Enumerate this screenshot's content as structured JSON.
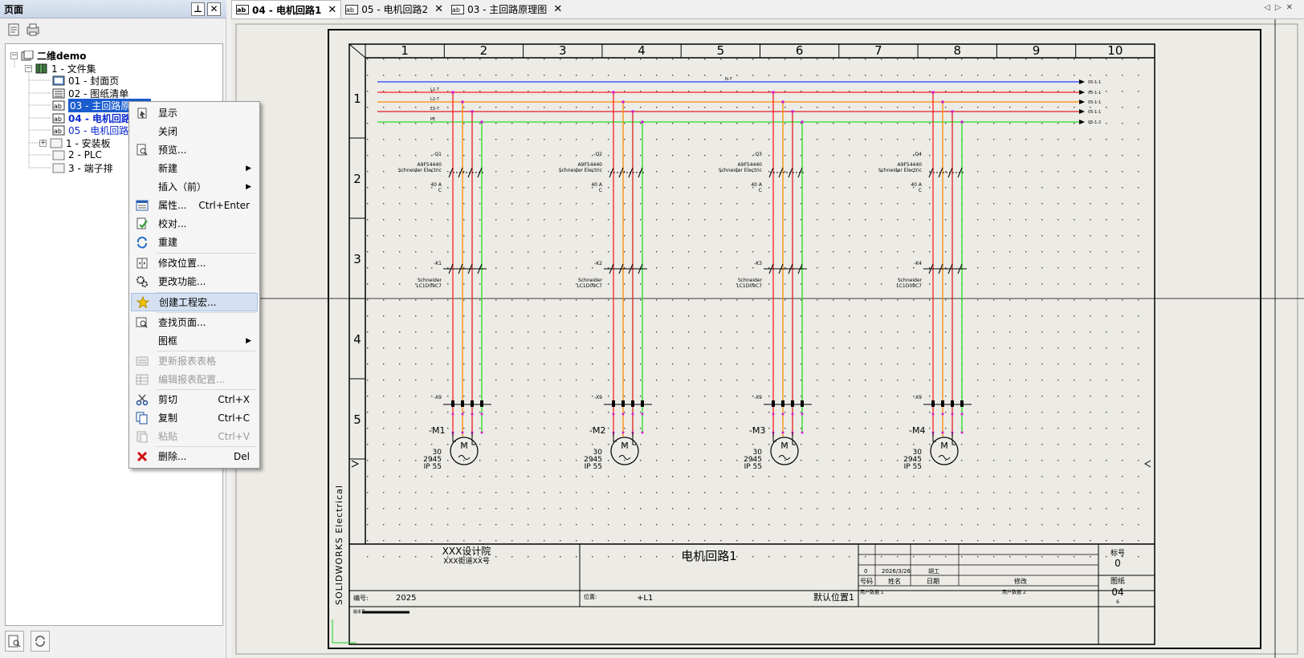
{
  "panel": {
    "title": "页面",
    "pin_label": "⊥",
    "close_label": "✕"
  },
  "tree": {
    "root": "二维demo",
    "folder": "1 - 文件集",
    "items": [
      {
        "label": "01 - 封面页"
      },
      {
        "label": "02 - 图纸清单"
      },
      {
        "label": "03 - 主回路原理图"
      },
      {
        "label": "04 - 电机回路1"
      },
      {
        "label": "05 - 电机回路2"
      }
    ],
    "groups": [
      {
        "label": "1 - 安装板"
      },
      {
        "label": "2 - PLC"
      },
      {
        "label": "3 - 端子排"
      }
    ]
  },
  "context_menu": {
    "items": [
      {
        "label": "显示",
        "shortcut": ""
      },
      {
        "label": "关闭",
        "shortcut": ""
      },
      {
        "label": "预览...",
        "shortcut": ""
      },
      {
        "label": "新建",
        "shortcut": ""
      },
      {
        "label": "插入（前）",
        "shortcut": ""
      },
      {
        "label": "属性...",
        "shortcut": "Ctrl+Enter"
      },
      {
        "label": "校对...",
        "shortcut": ""
      },
      {
        "label": "重建",
        "shortcut": ""
      },
      {
        "label": "修改位置...",
        "shortcut": ""
      },
      {
        "label": "更改功能...",
        "shortcut": ""
      },
      {
        "label": "创建工程宏...",
        "shortcut": ""
      },
      {
        "label": "查找页面...",
        "shortcut": ""
      },
      {
        "label": "图框",
        "shortcut": ""
      },
      {
        "label": "更新报表表格",
        "shortcut": ""
      },
      {
        "label": "编辑报表配置...",
        "shortcut": ""
      },
      {
        "label": "剪切",
        "shortcut": "Ctrl+X"
      },
      {
        "label": "复制",
        "shortcut": "Ctrl+C"
      },
      {
        "label": "粘贴",
        "shortcut": "Ctrl+V"
      },
      {
        "label": "删除...",
        "shortcut": "Del"
      }
    ]
  },
  "tabs": [
    {
      "label": "04 - 电机回路1",
      "close": "✕"
    },
    {
      "label": "05 - 电机回路2",
      "close": "✕"
    },
    {
      "label": "03 - 主回路原理图",
      "close": "✕"
    }
  ],
  "tab_nav": "◁▷✕",
  "drawing": {
    "columns": [
      "1",
      "2",
      "3",
      "4",
      "5",
      "6",
      "7",
      "8",
      "9",
      "10"
    ],
    "rows": [
      "1",
      "2",
      "3",
      "4",
      "5"
    ],
    "bus_labels": [
      "N-7",
      "L1-7",
      "L2-7",
      "L3-7",
      "PE"
    ],
    "bus_targets": [
      "05-1-1",
      "05-1-1",
      "05-1-1",
      "05-1-1",
      "05-1-2"
    ],
    "breakers": [
      {
        "tag": "-Q1",
        "model": "A9F54440",
        "maker": "Schneider Electric",
        "rating": "40 A",
        "curve": "C"
      },
      {
        "tag": "-Q2",
        "model": "A9F54440",
        "maker": "Schneider Electric",
        "rating": "40 A",
        "curve": "C"
      },
      {
        "tag": "-Q3",
        "model": "A9F54440",
        "maker": "Schneider Electric",
        "rating": "40 A",
        "curve": "C"
      },
      {
        "tag": "-Q4",
        "model": "A9F54440",
        "maker": "Schneider Electric",
        "rating": "40 A",
        "curve": "C"
      }
    ],
    "contactors": [
      {
        "tag": "-K1",
        "maker": "Schneider",
        "model": "LC1D09C7"
      },
      {
        "tag": "-K2",
        "maker": "Schneider",
        "model": "LC1D09C7"
      },
      {
        "tag": "-K3",
        "maker": "Schneider",
        "model": "LC1D09C7"
      },
      {
        "tag": "-K4",
        "maker": "Schneider",
        "model": "LC1D09C7"
      }
    ],
    "terminals": [
      "-X9",
      "-X9",
      "-X9",
      "-X9"
    ],
    "motors": [
      {
        "tag": "-M1",
        "power": "30",
        "speed": "2945",
        "ip": "IP 55"
      },
      {
        "tag": "-M2",
        "power": "30",
        "speed": "2945",
        "ip": "IP 55"
      },
      {
        "tag": "-M3",
        "power": "30",
        "speed": "2945",
        "ip": "IP 55"
      },
      {
        "tag": "-M4",
        "power": "30",
        "speed": "2945",
        "ip": "IP 55"
      }
    ],
    "motor_symbol": "M",
    "side_text": "SOLIDWORKS Electrical",
    "title_block": {
      "company": "XXX设计院",
      "address": "XXX街道XX号",
      "title": "电机回路1",
      "number_label": "编号:",
      "number_value": "2025",
      "position_label": "位置:",
      "position_value": "+L1",
      "default_position": "默认位置1",
      "rev": "0",
      "date": "2026/3/26",
      "author": "胡工",
      "hdr_no": "号码",
      "hdr_name": "姓名",
      "hdr_date": "日期",
      "hdr_mod": "修改",
      "user_data_1": "用户数据 1",
      "user_data_2": "用户数据 2",
      "mark_label": "标号",
      "mark_value": "0",
      "sheet_label": "图纸",
      "sheet_value": "04",
      "sheet_total": "6",
      "version_label": "版本号"
    }
  }
}
